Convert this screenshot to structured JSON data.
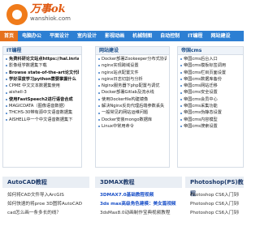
{
  "header": {
    "logo_title": "万事ok",
    "logo_sub": "wanshiok.com"
  },
  "nav": [
    "首页",
    "电脑办公",
    "平面设计",
    "室内设计",
    "影视动画",
    "机械制图",
    "自动控制",
    "IT编程",
    "网站建设"
  ],
  "panels": [
    {
      "title": "IT编程",
      "items": [
        {
          "text": "免费科研论文站点https://hal.inria.",
          "style": "bold"
        },
        {
          "text": "影像组学数据集下载",
          "style": "normal"
        },
        {
          "text": "Browse state-of-the-art论文代码",
          "style": "bold"
        },
        {
          "text": "学好深度学习python需要掌握什么",
          "style": "bold"
        },
        {
          "text": "CPME 中文文本数据集使用",
          "style": "normal"
        },
        {
          "text": "aishell-3",
          "style": "normal"
        },
        {
          "text": "使用FastSpeech2进行语音合成",
          "style": "bold"
        },
        {
          "text": "MAGICDATA（图像语音数据）",
          "style": "normal"
        },
        {
          "text": "THCHS-30带有源中文语音数据集",
          "style": "normal"
        },
        {
          "text": "AISHELL中一个中文语音数据集下",
          "style": "normal"
        }
      ]
    },
    {
      "title": "网站建设",
      "items": [
        {
          "text": "Docker部署Zookeeper分布式协调",
          "style": "normal"
        },
        {
          "text": "nginx实现跨域设置",
          "style": "normal"
        },
        {
          "text": "nginx站点配置文件",
          "style": "normal"
        },
        {
          "text": "nginx日志切割与分析",
          "style": "normal"
        },
        {
          "text": "Nginx服务器下php配置与调优",
          "style": "normal"
        },
        {
          "text": "Docker部署Gitlab及流水线",
          "style": "normal"
        },
        {
          "text": "使用Dockerfile构建镜像",
          "style": "normal"
        },
        {
          "text": "解决Nginx反向代理后端参数丢失",
          "style": "normal"
        },
        {
          "text": "一般常见的网站运维问题",
          "style": "normal"
        },
        {
          "text": "Docker安装mongo数据库",
          "style": "normal"
        },
        {
          "text": "Linux中常用命令",
          "style": "normal"
        }
      ]
    },
    {
      "title": "帝国cms",
      "items": [
        {
          "text": "帝国cms后台入口",
          "style": "normal"
        },
        {
          "text": "帝国cms模板标签调用",
          "style": "normal"
        },
        {
          "text": "帝国cms栏目页面设置",
          "style": "normal"
        },
        {
          "text": "帝国cms数据库备份",
          "style": "normal"
        },
        {
          "text": "帝国cms网站迁移",
          "style": "normal"
        },
        {
          "text": "帝国cms安全设置",
          "style": "normal"
        },
        {
          "text": "帝国cms会员中心",
          "style": "normal"
        },
        {
          "text": "帝国cms采集功能",
          "style": "normal"
        },
        {
          "text": "帝国cms伪静态设置",
          "style": "normal"
        },
        {
          "text": "帝国cms内容模型",
          "style": "normal"
        },
        {
          "text": "帝国cms搜索设置",
          "style": "normal"
        }
      ]
    }
  ],
  "sections": [
    {
      "title": "AutoCAD教程",
      "items": [
        {
          "text": "如何将CAD文件导入ArcGIS",
          "style": "normal"
        },
        {
          "text": "如何快速的将proe 3D图转AutoCAD",
          "style": "normal"
        },
        {
          "text": "cad怎么画一条多长的线？",
          "style": "normal"
        }
      ]
    },
    {
      "title": "3DMAX教程",
      "items": [
        {
          "text": "3DMAX7.0基础教程视频",
          "style": "blue"
        },
        {
          "text": "3ds max高级角色建模：美女篇视频",
          "style": "blue"
        },
        {
          "text": "3dsMax8.0动画制作宝典视频教程",
          "style": "normal"
        }
      ]
    },
    {
      "title": "Photoshop(PS)教程",
      "items": [
        {
          "text": "Photoshop CS6入门到精通",
          "style": "normal"
        },
        {
          "text": "Photoshop CS6入门到精通",
          "style": "normal"
        },
        {
          "text": "Photoshop CS6入门到精通",
          "style": "normal"
        }
      ]
    }
  ]
}
